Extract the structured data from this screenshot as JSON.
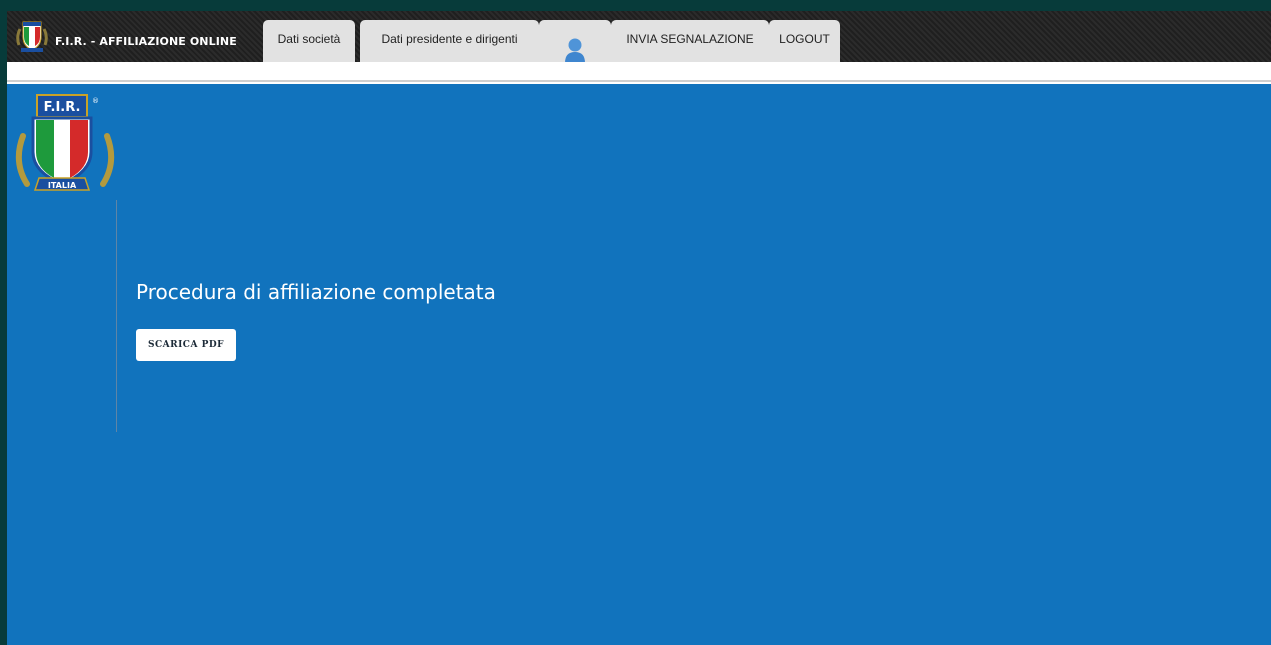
{
  "header": {
    "brand_title": "F.I.R. - AFFILIAZIONE ONLINE",
    "background_color": "#262626",
    "tabs": [
      {
        "label": "Dati società"
      },
      {
        "label": "Dati presidente e dirigenti"
      },
      {
        "label": "",
        "icon": "user-icon"
      },
      {
        "label": "INVIA SEGNALAZIONE"
      },
      {
        "label": "LOGOUT"
      }
    ]
  },
  "logo": {
    "label": "F.I.R.",
    "banner": "ITALIA",
    "mark": "®"
  },
  "main": {
    "heading": "Procedura di affiliazione completata",
    "download_button_label": "SCARICA PDF",
    "background_color": "#1173bd"
  }
}
